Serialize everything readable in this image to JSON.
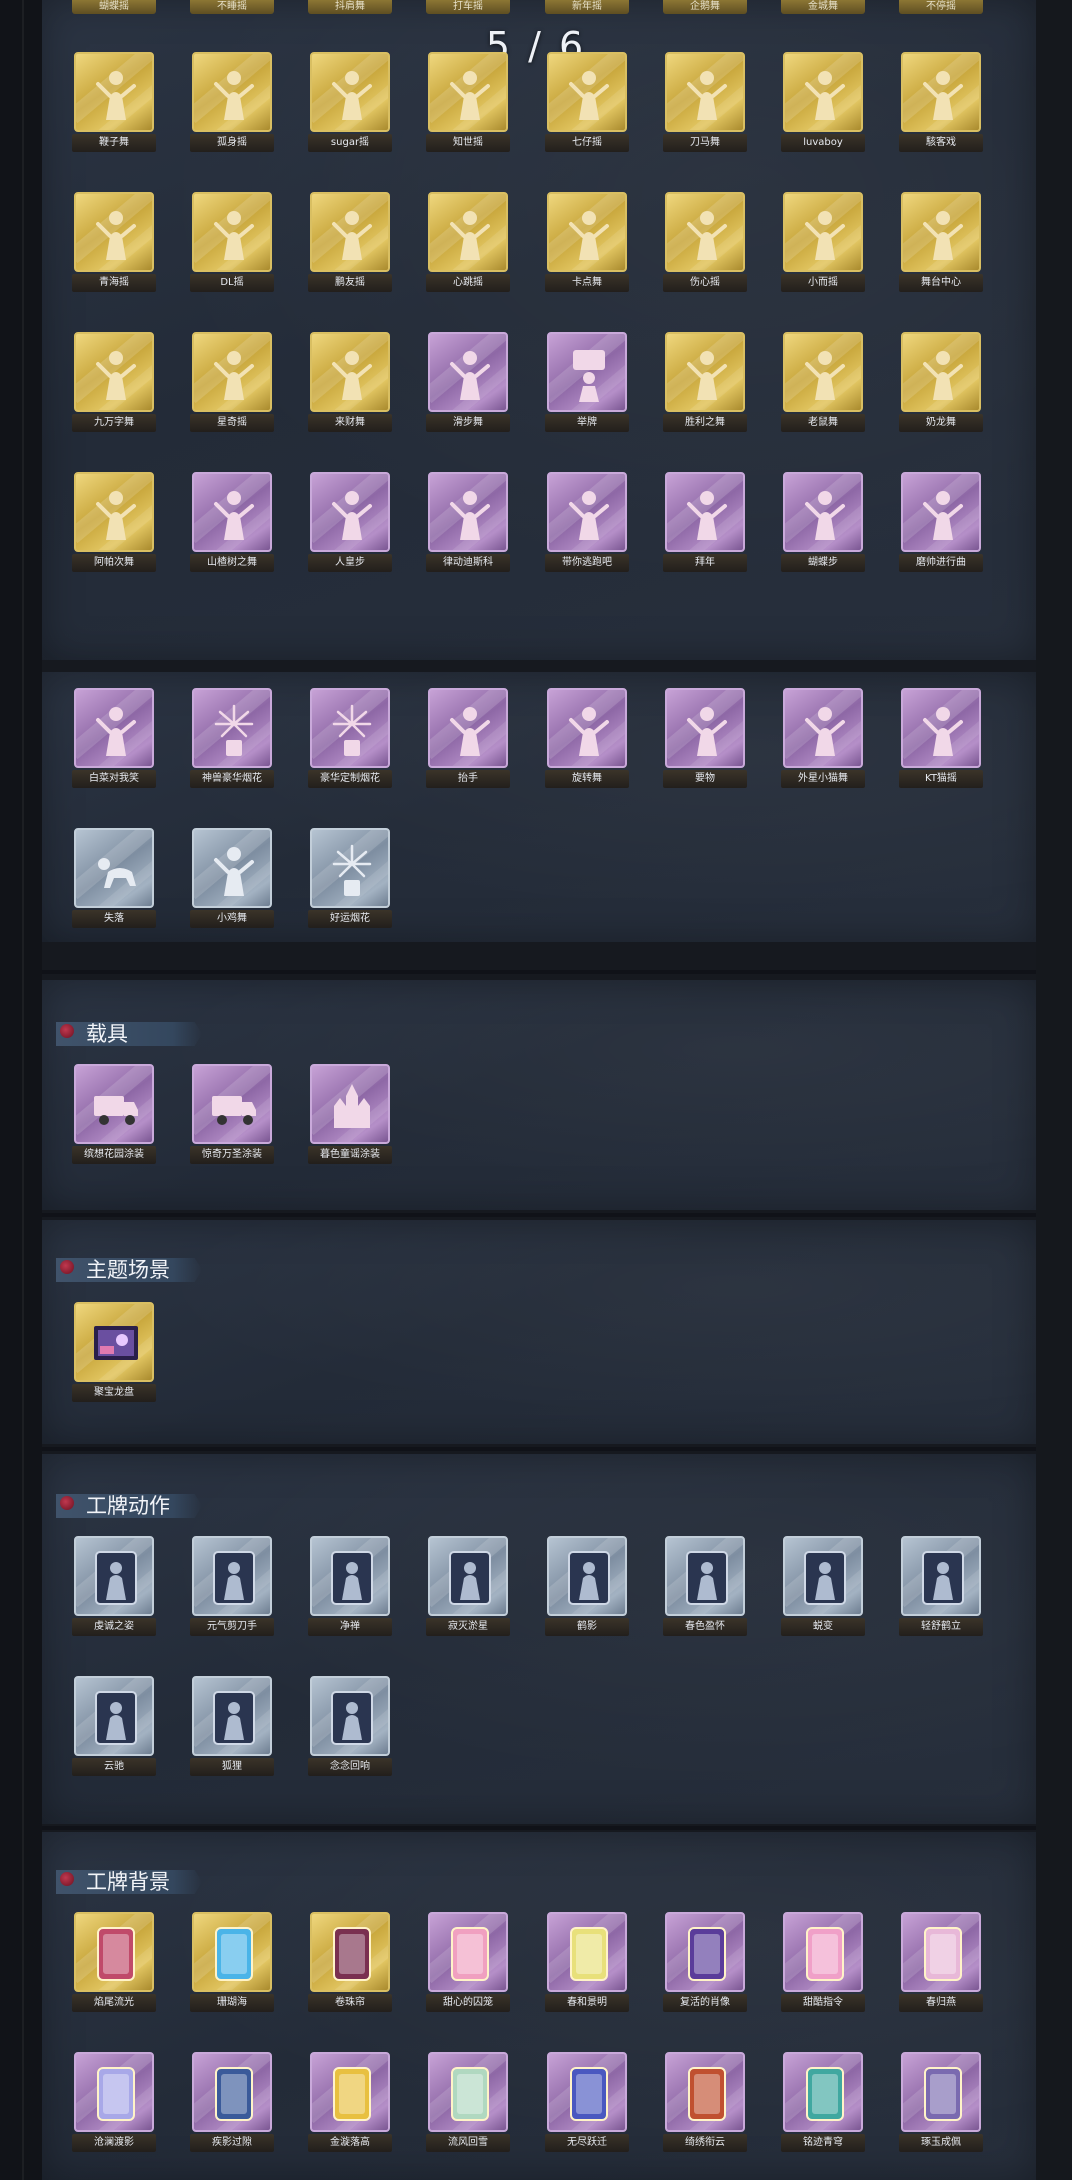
{
  "page_indicator": "5 / 6",
  "colors": {
    "gold": "#d8bd5e",
    "purple": "#a27fbb",
    "blue": "#94a3b6",
    "panel": "#262e3b",
    "accent_red": "#b0283f"
  },
  "top_row_labels": [
    "蝴蝶摇",
    "不睡摇",
    "抖肩舞",
    "打车摇",
    "新年摇",
    "企鹅舞",
    "金城舞",
    "不停摇"
  ],
  "sections": [
    {
      "id": "dance",
      "title": "",
      "rows": [
        [
          {
            "label": "鞭子舞",
            "rarity": "gold",
            "icon": "dancer-icon"
          },
          {
            "label": "孤身摇",
            "rarity": "gold",
            "icon": "dancer-icon"
          },
          {
            "label": "sugar摇",
            "rarity": "gold",
            "icon": "dancer-icon"
          },
          {
            "label": "知世摇",
            "rarity": "gold",
            "icon": "dancer-icon"
          },
          {
            "label": "七仔摇",
            "rarity": "gold",
            "icon": "dancer-icon"
          },
          {
            "label": "刀马舞",
            "rarity": "gold",
            "icon": "dancer-icon"
          },
          {
            "label": "luvaboy",
            "rarity": "gold",
            "icon": "dancer-icon"
          },
          {
            "label": "駭客戏",
            "rarity": "gold",
            "icon": "dancer-icon"
          }
        ],
        [
          {
            "label": "青海摇",
            "rarity": "gold",
            "icon": "dancer-icon"
          },
          {
            "label": "DL摇",
            "rarity": "gold",
            "icon": "dancer-icon"
          },
          {
            "label": "鹏友摇",
            "rarity": "gold",
            "icon": "dancer-icon"
          },
          {
            "label": "心跳摇",
            "rarity": "gold",
            "icon": "dancer-icon"
          },
          {
            "label": "卡点舞",
            "rarity": "gold",
            "icon": "dancer-icon"
          },
          {
            "label": "伤心摇",
            "rarity": "gold",
            "icon": "dancer-icon"
          },
          {
            "label": "小而摇",
            "rarity": "gold",
            "icon": "dancer-icon"
          },
          {
            "label": "舞台中心",
            "rarity": "gold",
            "icon": "dancer-icon"
          }
        ],
        [
          {
            "label": "九万字舞",
            "rarity": "gold",
            "icon": "dancer-icon"
          },
          {
            "label": "星奇摇",
            "rarity": "gold",
            "icon": "dancer-icon"
          },
          {
            "label": "来财舞",
            "rarity": "gold",
            "icon": "dancer-icon"
          },
          {
            "label": "滑步舞",
            "rarity": "purple",
            "icon": "dancer-icon"
          },
          {
            "label": "举牌",
            "rarity": "purple",
            "icon": "sign-icon"
          },
          {
            "label": "胜利之舞",
            "rarity": "gold",
            "icon": "dancer-icon"
          },
          {
            "label": "老鼠舞",
            "rarity": "gold",
            "icon": "dancer-icon"
          },
          {
            "label": "奶龙舞",
            "rarity": "gold",
            "icon": "dancer-icon"
          }
        ],
        [
          {
            "label": "阿帕次舞",
            "rarity": "gold",
            "icon": "dancer-icon"
          },
          {
            "label": "山楂树之舞",
            "rarity": "purple",
            "icon": "dancer-icon"
          },
          {
            "label": "人皇步",
            "rarity": "purple",
            "icon": "dancer-icon"
          },
          {
            "label": "律动迪斯科",
            "rarity": "purple",
            "icon": "dancer-icon"
          },
          {
            "label": "带你逃跑吧",
            "rarity": "purple",
            "icon": "dancer-icon"
          },
          {
            "label": "拜年",
            "rarity": "purple",
            "icon": "dancer-icon"
          },
          {
            "label": "蝴蝶步",
            "rarity": "purple",
            "icon": "dancer-icon"
          },
          {
            "label": "磨帅进行曲",
            "rarity": "purple",
            "icon": "dancer-icon"
          }
        ]
      ]
    },
    {
      "id": "emotes",
      "title": "",
      "rows": [
        [
          {
            "label": "白菜对我笑",
            "rarity": "purple",
            "icon": "dancer-icon"
          },
          {
            "label": "神兽豪华烟花",
            "rarity": "purple",
            "icon": "firework-icon"
          },
          {
            "label": "豪华定制烟花",
            "rarity": "purple",
            "icon": "firework-icon"
          },
          {
            "label": "抬手",
            "rarity": "purple",
            "icon": "dancer-icon"
          },
          {
            "label": "旋转舞",
            "rarity": "purple",
            "icon": "dancer-icon"
          },
          {
            "label": "要物",
            "rarity": "purple",
            "icon": "dancer-icon"
          },
          {
            "label": "外星小猫舞",
            "rarity": "purple",
            "icon": "dancer-icon"
          },
          {
            "label": "KT猫摇",
            "rarity": "purple",
            "icon": "dancer-icon"
          }
        ],
        [
          {
            "label": "失落",
            "rarity": "blue",
            "icon": "crawl-icon"
          },
          {
            "label": "小鸡舞",
            "rarity": "blue",
            "icon": "dancer-icon"
          },
          {
            "label": "好运烟花",
            "rarity": "blue",
            "icon": "firework-icon"
          }
        ]
      ]
    },
    {
      "id": "vehicles",
      "title": "载具",
      "rows": [
        [
          {
            "label": "缤想花园涂装",
            "rarity": "purple",
            "icon": "truck-icon"
          },
          {
            "label": "惊奇万圣涂装",
            "rarity": "purple",
            "icon": "truck-icon"
          },
          {
            "label": "暮色童谣涂装",
            "rarity": "purple",
            "icon": "castle-icon"
          }
        ]
      ]
    },
    {
      "id": "theme_scene",
      "title": "主题场景",
      "rows": [
        [
          {
            "label": "聚宝龙盘",
            "rarity": "gold",
            "icon": "scene-icon"
          }
        ]
      ]
    },
    {
      "id": "badge_actions",
      "title": "工牌动作",
      "rows": [
        [
          {
            "label": "虔诚之姿",
            "rarity": "blue",
            "icon": "badge-figure-icon"
          },
          {
            "label": "元气剪刀手",
            "rarity": "blue",
            "icon": "badge-figure-icon"
          },
          {
            "label": "净禅",
            "rarity": "blue",
            "icon": "badge-figure-icon"
          },
          {
            "label": "寂灭淤星",
            "rarity": "blue",
            "icon": "badge-figure-icon"
          },
          {
            "label": "鹤影",
            "rarity": "blue",
            "icon": "badge-figure-icon"
          },
          {
            "label": "春色盈怀",
            "rarity": "blue",
            "icon": "badge-figure-icon"
          },
          {
            "label": "蜕变",
            "rarity": "blue",
            "icon": "badge-figure-icon"
          },
          {
            "label": "轻舒鹤立",
            "rarity": "blue",
            "icon": "badge-figure-icon"
          }
        ],
        [
          {
            "label": "云驰",
            "rarity": "blue",
            "icon": "badge-figure-icon"
          },
          {
            "label": "狐狸",
            "rarity": "blue",
            "icon": "badge-figure-icon"
          },
          {
            "label": "念念回响",
            "rarity": "blue",
            "icon": "badge-figure-icon"
          }
        ]
      ]
    },
    {
      "id": "badge_backgrounds",
      "title": "工牌背景",
      "rows": [
        [
          {
            "label": "焰尾流光",
            "rarity": "gold",
            "icon": "badge-frame-icon"
          },
          {
            "label": "珊瑚海",
            "rarity": "gold",
            "icon": "badge-frame-icon"
          },
          {
            "label": "卷珠帘",
            "rarity": "gold",
            "icon": "badge-frame-icon"
          },
          {
            "label": "甜心的囚笼",
            "rarity": "purple",
            "icon": "badge-frame-icon"
          },
          {
            "label": "春和景明",
            "rarity": "purple",
            "icon": "badge-frame-icon"
          },
          {
            "label": "复活的肖像",
            "rarity": "purple",
            "icon": "badge-frame-icon"
          },
          {
            "label": "甜酷指令",
            "rarity": "purple",
            "icon": "badge-frame-icon"
          },
          {
            "label": "春归燕",
            "rarity": "purple",
            "icon": "badge-frame-icon"
          }
        ],
        [
          {
            "label": "沧澜渡影",
            "rarity": "purple",
            "icon": "badge-frame-icon"
          },
          {
            "label": "疾影过隙",
            "rarity": "purple",
            "icon": "badge-frame-icon"
          },
          {
            "label": "金漩落高",
            "rarity": "purple",
            "icon": "badge-frame-icon"
          },
          {
            "label": "流风回雪",
            "rarity": "purple",
            "icon": "badge-frame-icon"
          },
          {
            "label": "无尽跃迁",
            "rarity": "purple",
            "icon": "badge-frame-icon"
          },
          {
            "label": "绮绣衔云",
            "rarity": "purple",
            "icon": "badge-frame-icon"
          },
          {
            "label": "铭迹青穹",
            "rarity": "purple",
            "icon": "badge-frame-icon"
          },
          {
            "label": "琢玉成佩",
            "rarity": "purple",
            "icon": "badge-frame-icon"
          }
        ]
      ]
    }
  ]
}
